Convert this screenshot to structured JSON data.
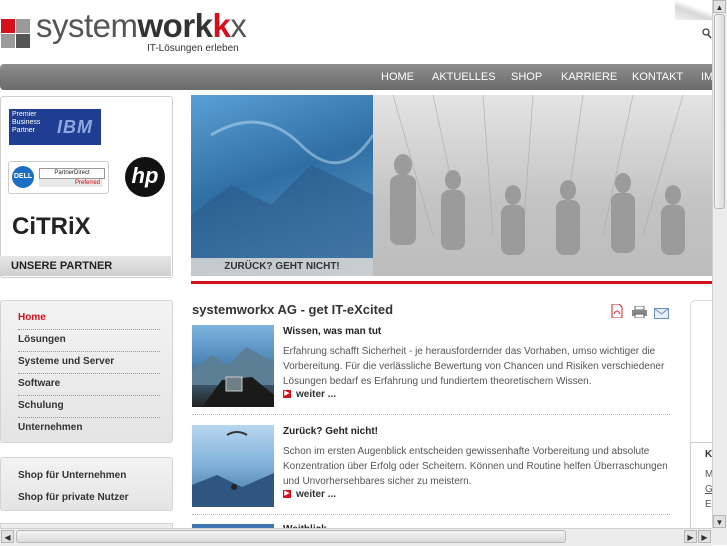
{
  "logo": {
    "text_system": "system",
    "text_work": "work",
    "text_x": "x",
    "tagline": "IT-Lösungen erleben"
  },
  "nav": {
    "items": [
      "HOME",
      "AKTUELLES",
      "SHOP",
      "KARRIERE",
      "KONTAKT",
      "IM"
    ]
  },
  "partners": {
    "ibm": {
      "line1": "Premier",
      "line2": "Business",
      "line3": "Partner",
      "brand": "IBM"
    },
    "dell": {
      "brand": "DELL",
      "line1": "PartnerDirect",
      "line2": "Preferred"
    },
    "hp": "hp",
    "citrix": "CiTRiX",
    "label": "UNSERE PARTNER"
  },
  "hero": {
    "caption": "ZURÜCK? GEHT NICHT!"
  },
  "menu": {
    "items": [
      "Home",
      "Lösungen",
      "Systeme und Server",
      "Software",
      "Schulung",
      "Unternehmen"
    ],
    "active": "Home"
  },
  "shop": {
    "items": [
      "Shop für Unternehmen",
      "Shop für private Nutzer"
    ]
  },
  "content": {
    "title": "systemworkx AG - get IT-eXcited",
    "articles": [
      {
        "heading": "Wissen, was man tut",
        "text": "Erfahrung schafft Sicherheit - je herausfordernder das Vorhaben, umso wichtiger die Vorbereitung. Für die verlässliche Bewertung von Chancen und Risiken verschiedener Lösungen bedarf es Erfahrung und fundiertem theoretischem Wissen.",
        "more": "weiter ..."
      },
      {
        "heading": "Zurück? Geht nicht!",
        "text": "Schon im ersten Augenblick entscheiden gewissenhafte Vorbereitung und absolute Konzentration über Erfolg oder Scheitern. Können und Routine helfen Überraschungen und Unvorhersehbares sicher zu meistern.",
        "more": "weiter ..."
      },
      {
        "heading": "Weitblick",
        "text": "",
        "more": ""
      }
    ]
  },
  "side_panel": {
    "heading": "K",
    "line1": "M",
    "line2": "G",
    "line3": "E"
  },
  "icons": {
    "pdf": "pdf-icon",
    "print": "print-icon",
    "mail": "mail-icon",
    "search": "search-icon"
  },
  "colors": {
    "brand_red": "#d60f1a",
    "nav_gray": "#7a7a7a"
  }
}
